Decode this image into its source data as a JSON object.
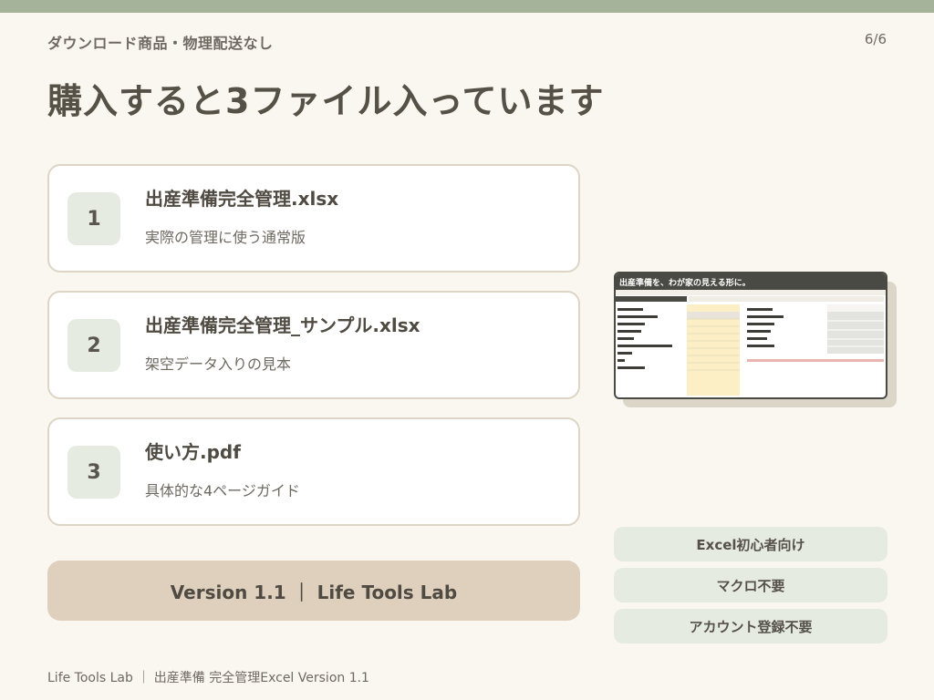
{
  "header": {
    "eyebrow": "ダウンロード商品・物理配送なし",
    "page_number": "6/6",
    "title": "購入すると3ファイル入っています"
  },
  "files": [
    {
      "number": "1",
      "name": "出産準備完全管理.xlsx",
      "description": "実際の管理に使う通常版"
    },
    {
      "number": "2",
      "name": "出産準備完全管理_サンプル.xlsx",
      "description": "架空データ入りの見本"
    },
    {
      "number": "3",
      "name": "使い方.pdf",
      "description": "具体的な4ページガイド"
    }
  ],
  "version_label": "Version 1.1 ｜ Life Tools Lab",
  "preview": {
    "title": "出産準備を、わが家の見える形に。"
  },
  "tags": [
    "Excel初心者向け",
    "マクロ不要",
    "アカウント登録不要"
  ],
  "footer": "Life Tools Lab ｜ 出産準備 完全管理Excel  Version 1.1",
  "colors": {
    "background": "#faf7f0",
    "accent_bar": "#a6b39b",
    "number_badge": "#e6ebe2",
    "version_bar": "#ded0bd"
  }
}
